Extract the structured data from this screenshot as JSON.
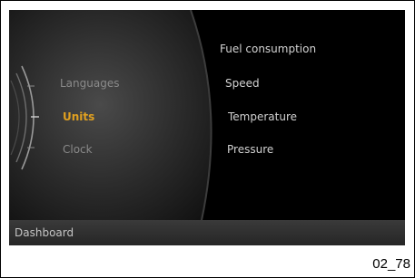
{
  "left_menu": {
    "items": [
      {
        "label": "Languages",
        "selected": false
      },
      {
        "label": "Units",
        "selected": true
      },
      {
        "label": "Clock",
        "selected": false
      }
    ]
  },
  "right_menu": {
    "items": [
      {
        "label": "Fuel consumption"
      },
      {
        "label": "Speed"
      },
      {
        "label": "Temperature"
      },
      {
        "label": "Pressure"
      }
    ]
  },
  "footer": {
    "label": "Dashboard"
  },
  "figure_caption": "02_78",
  "colors": {
    "selected_text": "#e0a020",
    "unselected_text": "#8a8a8a",
    "submenu_text": "#d2d2d2",
    "screen_bg": "#000000"
  }
}
